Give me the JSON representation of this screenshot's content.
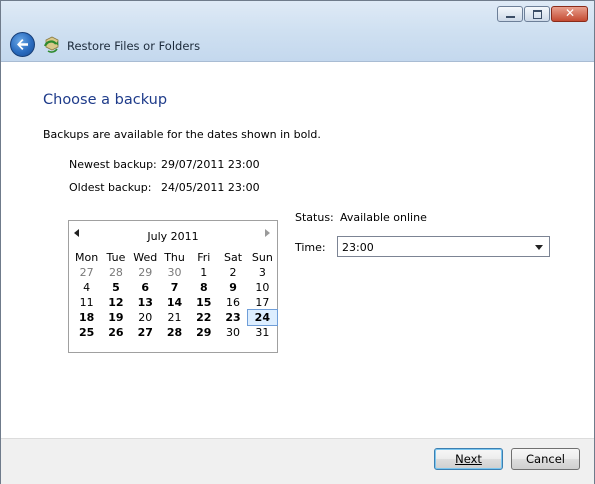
{
  "window": {
    "title": "Restore Files or Folders"
  },
  "page": {
    "heading": "Choose a backup",
    "description": "Backups are available for the dates shown in bold.",
    "newest_label": "Newest backup:",
    "newest_value": "29/07/2011 23:00",
    "oldest_label": "Oldest backup:",
    "oldest_value": "24/05/2011 23:00"
  },
  "calendar": {
    "month_label": "July 2011",
    "weekdays": [
      "Mon",
      "Tue",
      "Wed",
      "Thu",
      "Fri",
      "Sat",
      "Sun"
    ],
    "weeks": [
      [
        {
          "d": "27",
          "o": true
        },
        {
          "d": "28",
          "o": true
        },
        {
          "d": "29",
          "o": true
        },
        {
          "d": "30",
          "o": true
        },
        {
          "d": "1"
        },
        {
          "d": "2"
        },
        {
          "d": "3"
        }
      ],
      [
        {
          "d": "4"
        },
        {
          "d": "5",
          "b": true
        },
        {
          "d": "6",
          "b": true
        },
        {
          "d": "7",
          "b": true
        },
        {
          "d": "8",
          "b": true
        },
        {
          "d": "9",
          "b": true
        },
        {
          "d": "10"
        }
      ],
      [
        {
          "d": "11"
        },
        {
          "d": "12",
          "b": true
        },
        {
          "d": "13",
          "b": true
        },
        {
          "d": "14",
          "b": true
        },
        {
          "d": "15",
          "b": true
        },
        {
          "d": "16"
        },
        {
          "d": "17"
        }
      ],
      [
        {
          "d": "18",
          "b": true
        },
        {
          "d": "19",
          "b": true
        },
        {
          "d": "20"
        },
        {
          "d": "21"
        },
        {
          "d": "22",
          "b": true
        },
        {
          "d": "23",
          "b": true
        },
        {
          "d": "24",
          "b": true,
          "s": true
        }
      ],
      [
        {
          "d": "25",
          "b": true
        },
        {
          "d": "26",
          "b": true
        },
        {
          "d": "27",
          "b": true
        },
        {
          "d": "28",
          "b": true
        },
        {
          "d": "29",
          "b": true
        },
        {
          "d": "30"
        },
        {
          "d": "31"
        }
      ]
    ]
  },
  "status": {
    "label": "Status:",
    "value": "Available online"
  },
  "time": {
    "label": "Time:",
    "selected": "23:00"
  },
  "buttons": {
    "next": "Next",
    "cancel": "Cancel"
  },
  "icons": {
    "back": "back-arrow-icon",
    "app": "restore-files-icon"
  }
}
